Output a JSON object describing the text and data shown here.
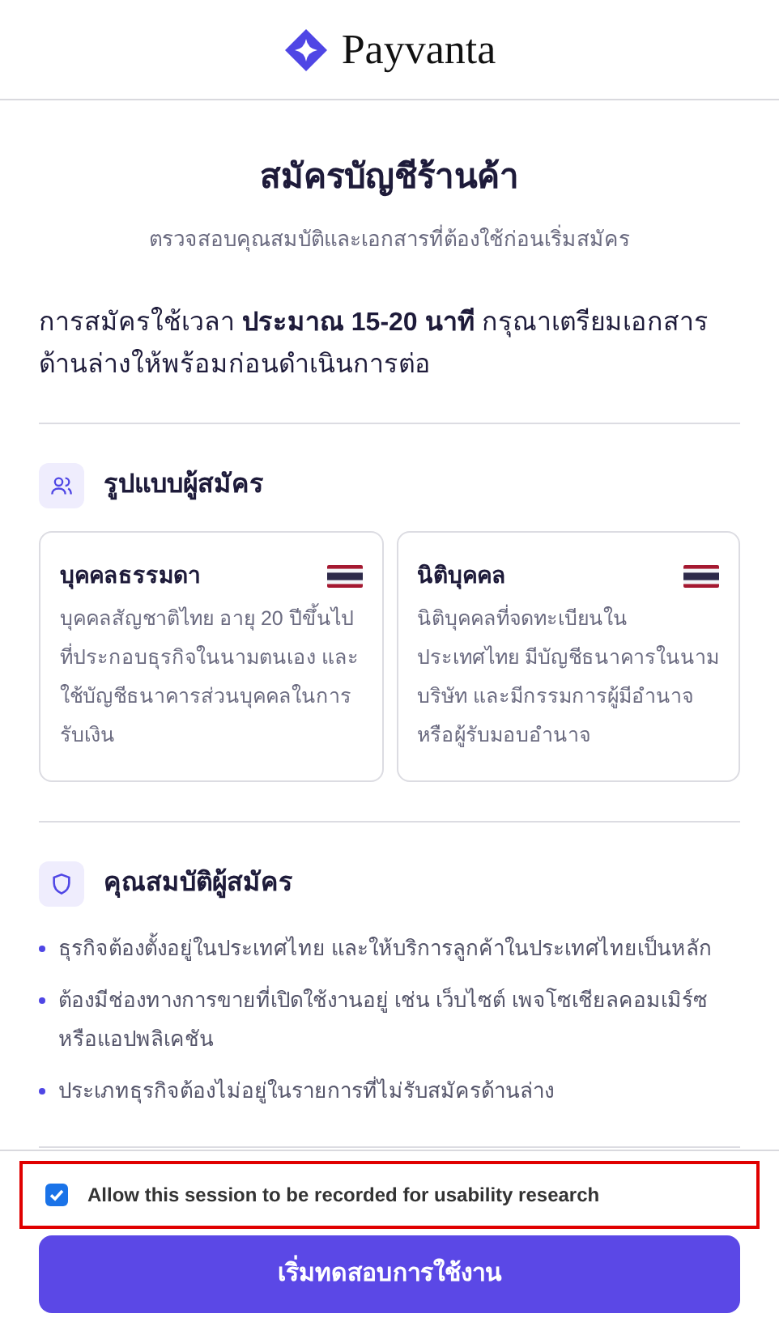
{
  "brand": {
    "name": "Payvanta"
  },
  "title": "สมัครบัญชีร้านค้า",
  "subtitle": "ตรวจสอบคุณสมบัติและเอกสารที่ต้องใช้ก่อนเริ่มสมัคร",
  "intro": "การสมัครใช้เวลา **ประมาณ 15-20 นาที** กรุณาเตรียมเอกสารด้านล่างให้พร้อมก่อนดำเนินการต่อ",
  "applicant_types": {
    "heading": "รูปแบบผู้สมัคร",
    "cards": [
      {
        "title": "บุคคลธรรมดา",
        "description": "บุคคลสัญชาติไทย อายุ 20 ปีขึ้นไปที่ประกอบธุรกิจในนามตนเอง และใช้บัญชีธนาคารส่วนบุคคลในการรับเงิน"
      },
      {
        "title": "นิติบุคคล",
        "description": "นิติบุคคลที่จดทะเบียนในประเทศไทย มีบัญชีธนาคารในนามบริษัท และมีกรรมการผู้มีอำนาจหรือผู้รับมอบอำนาจ"
      }
    ]
  },
  "qualifications": {
    "heading": "คุณสมบัติผู้สมัคร",
    "items": [
      "ธุรกิจต้องตั้งอยู่ในประเทศไทย และให้บริการลูกค้าในประเทศไทยเป็นหลัก",
      "ต้องมีช่องทางการขายที่เปิดใช้งานอยู่ เช่น เว็บไซต์ เพจโซเชียลคอมเมิร์ซ หรือแอปพลิเคชัน",
      "ประเภทธุรกิจต้องไม่อยู่ในรายการที่ไม่รับสมัครด้านล่าง"
    ]
  },
  "consent": {
    "label": "Allow this session to be recorded for usability research",
    "checked": true
  },
  "start_button": "เริ่มทดสอบการใช้งาน"
}
